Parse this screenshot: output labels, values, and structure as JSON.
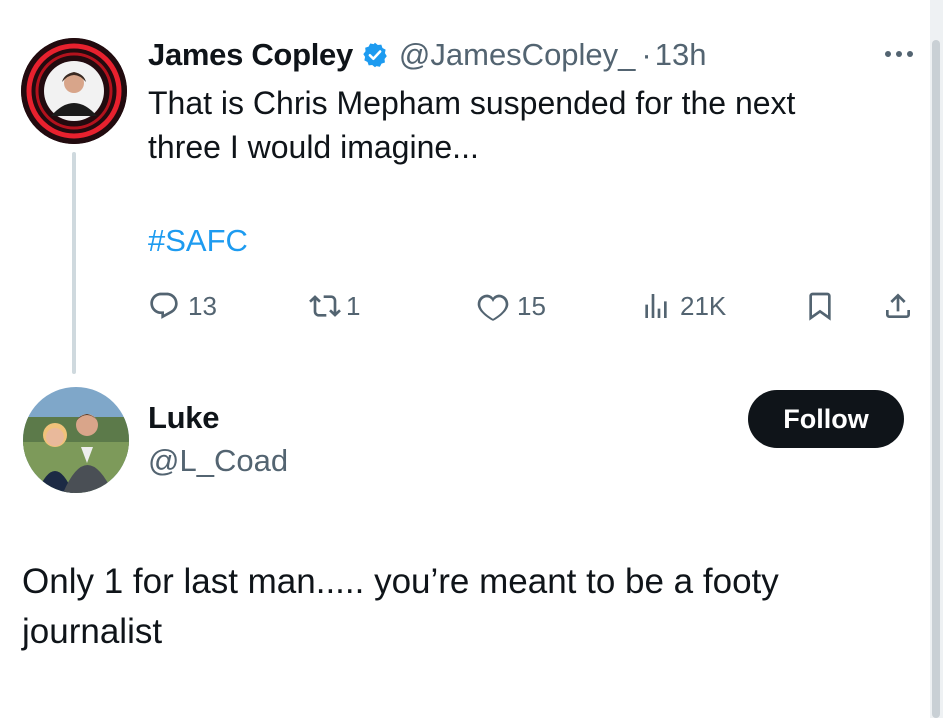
{
  "tweet": {
    "author_name": "James Copley",
    "verified_icon": "verified-badge-icon",
    "author_handle": "@JamesCopley_",
    "separator": "·",
    "time": "13h",
    "more_icon": "more-options-icon",
    "text_line1": "That is Chris Mepham suspended for the next",
    "text_line2": "three I would imagine...",
    "hashtag": "#SAFC",
    "actions": {
      "reply_count": "13",
      "retweet_count": "1",
      "like_count": "15",
      "views_count": "21K"
    }
  },
  "reply": {
    "author_name": "Luke",
    "author_handle": "@L_Coad",
    "follow_label": "Follow",
    "text_line1": "Only 1 for last man..... you’re meant to be a footy",
    "text_line2": "journalist"
  },
  "colors": {
    "accent": "#1d9bf0",
    "text": "#0f1419",
    "secondary_text": "#536471",
    "follow_bg": "#0f1419"
  }
}
